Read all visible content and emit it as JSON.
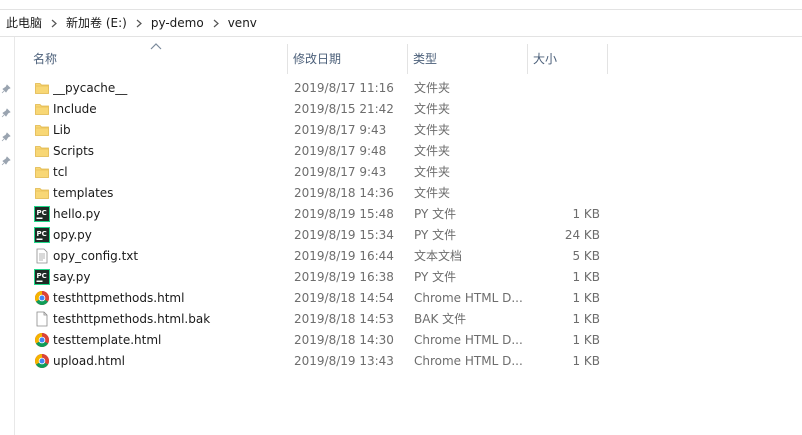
{
  "breadcrumb": [
    "此电脑",
    "新加卷 (E:)",
    "py-demo",
    "venv"
  ],
  "columns": {
    "name": "名称",
    "date": "修改日期",
    "type": "类型",
    "size": "大小"
  },
  "files": [
    {
      "name": "__pycache__",
      "date": "2019/8/17 11:16",
      "type": "文件夹",
      "size": "",
      "icon": "folder-icon"
    },
    {
      "name": "Include",
      "date": "2019/8/15 21:42",
      "type": "文件夹",
      "size": "",
      "icon": "folder-icon"
    },
    {
      "name": "Lib",
      "date": "2019/8/17 9:43",
      "type": "文件夹",
      "size": "",
      "icon": "folder-icon"
    },
    {
      "name": "Scripts",
      "date": "2019/8/17 9:48",
      "type": "文件夹",
      "size": "",
      "icon": "folder-icon"
    },
    {
      "name": "tcl",
      "date": "2019/8/17 9:43",
      "type": "文件夹",
      "size": "",
      "icon": "folder-icon"
    },
    {
      "name": "templates",
      "date": "2019/8/18 14:36",
      "type": "文件夹",
      "size": "",
      "icon": "folder-icon"
    },
    {
      "name": "hello.py",
      "date": "2019/8/19 15:48",
      "type": "PY 文件",
      "size": "1 KB",
      "icon": "pycharm-icon"
    },
    {
      "name": "opy.py",
      "date": "2019/8/19 15:34",
      "type": "PY 文件",
      "size": "24 KB",
      "icon": "pycharm-icon"
    },
    {
      "name": "opy_config.txt",
      "date": "2019/8/19 16:44",
      "type": "文本文档",
      "size": "5 KB",
      "icon": "text-file-icon"
    },
    {
      "name": "say.py",
      "date": "2019/8/19 16:38",
      "type": "PY 文件",
      "size": "1 KB",
      "icon": "pycharm-icon"
    },
    {
      "name": "testhttpmethods.html",
      "date": "2019/8/18 14:54",
      "type": "Chrome HTML D...",
      "size": "1 KB",
      "icon": "chrome-icon"
    },
    {
      "name": "testhttpmethods.html.bak",
      "date": "2019/8/18 14:53",
      "type": "BAK 文件",
      "size": "1 KB",
      "icon": "blank-file-icon"
    },
    {
      "name": "testtemplate.html",
      "date": "2019/8/18 14:30",
      "type": "Chrome HTML D...",
      "size": "1 KB",
      "icon": "chrome-icon"
    },
    {
      "name": "upload.html",
      "date": "2019/8/19 13:43",
      "type": "Chrome HTML D...",
      "size": "1 KB",
      "icon": "chrome-icon"
    }
  ],
  "colors": {
    "folder": "#f8d775",
    "folder_dark": "#e0b64a",
    "pycharm_bg": "#1e2a25",
    "header_text": "#4c607a",
    "secondary_text": "#6d6d6d"
  }
}
